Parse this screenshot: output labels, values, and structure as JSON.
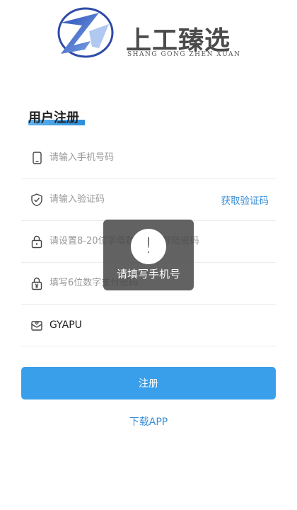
{
  "logo": {
    "cn": "上工臻选",
    "en": "SHANG GONG ZHEN XUAN"
  },
  "form": {
    "title": "用户注册",
    "phone_placeholder": "请输入手机号码",
    "code_placeholder": "请输入验证码",
    "get_code_label": "获取验证码",
    "login_password_placeholder": "请设置8-20位字母数字组合登陆密码",
    "pay_password_placeholder": "填写6位数字支付密码",
    "invite_code_value": "GYAPU",
    "submit_label": "注册",
    "download_label": "下载APP"
  },
  "toast": {
    "icon": "!",
    "message": "请填写手机号"
  },
  "colors": {
    "accent": "#3a9fea",
    "link": "#3a8fd6"
  }
}
